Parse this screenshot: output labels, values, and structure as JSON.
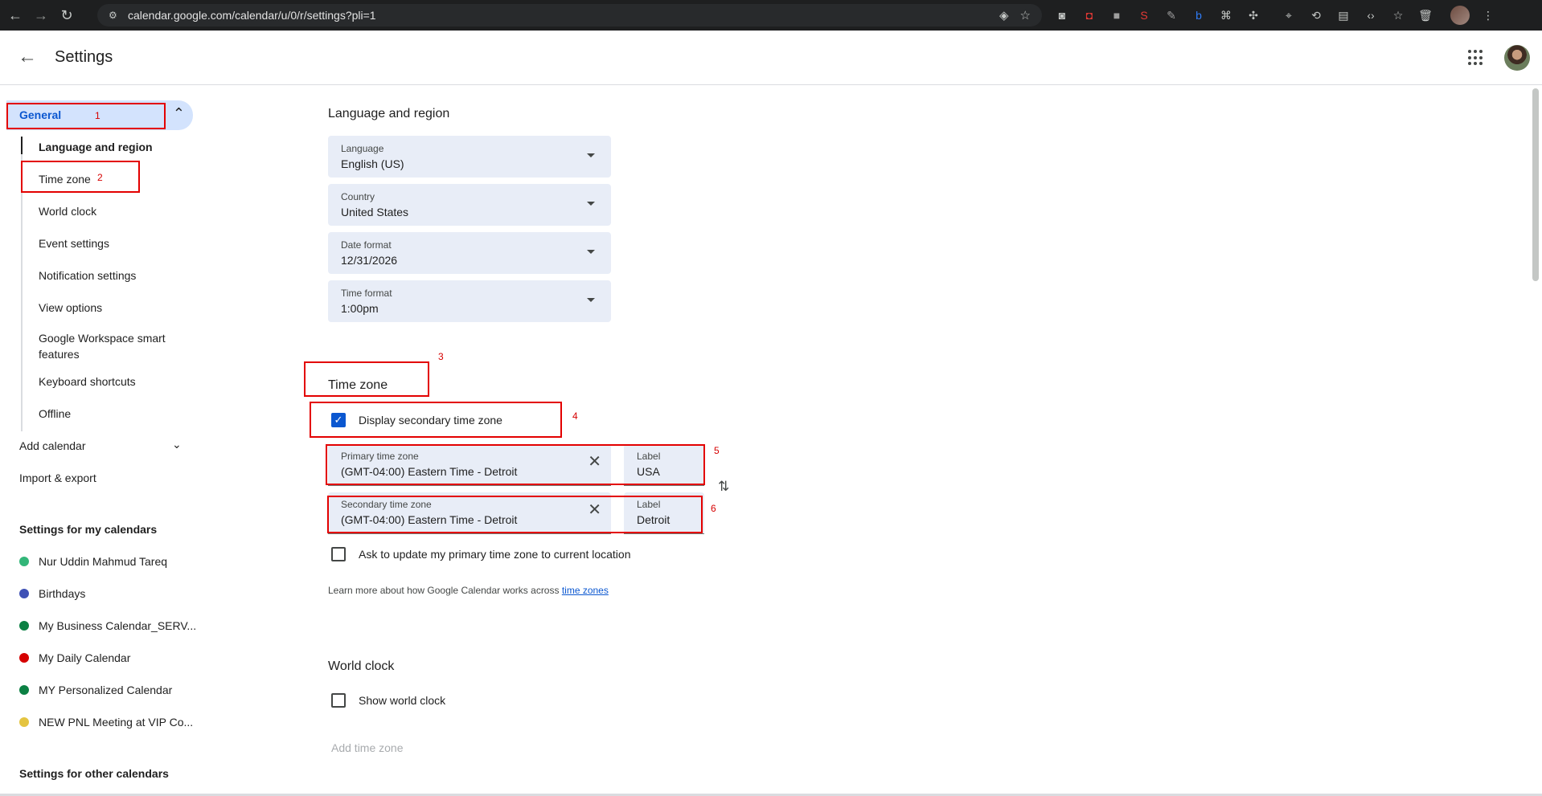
{
  "browser": {
    "url": "calendar.google.com/calendar/u/0/r/settings?pli=1"
  },
  "header": {
    "title": "Settings"
  },
  "sidebar": {
    "general": "General",
    "general_items": [
      "Language and region",
      "Time zone",
      "World clock",
      "Event settings",
      "Notification settings",
      "View options",
      "Google Workspace smart features",
      "Keyboard shortcuts",
      "Offline"
    ],
    "add_calendar": "Add calendar",
    "import_export": "Import & export",
    "my_calendars_heading": "Settings for my calendars",
    "my_calendars": [
      {
        "name": "Nur Uddin Mahmud Tareq",
        "color": "#33b679"
      },
      {
        "name": "Birthdays",
        "color": "#3f51b5"
      },
      {
        "name": "My Business Calendar_SERV...",
        "color": "#0b8043"
      },
      {
        "name": "My Daily Calendar",
        "color": "#d50000"
      },
      {
        "name": "MY Personalized Calendar",
        "color": "#0b8043"
      },
      {
        "name": "NEW PNL Meeting at VIP Co...",
        "color": "#e4c441"
      }
    ],
    "other_calendars_heading": "Settings for other calendars"
  },
  "language_region": {
    "title": "Language and region",
    "language": {
      "label": "Language",
      "value": "English (US)"
    },
    "country": {
      "label": "Country",
      "value": "United States"
    },
    "date_format": {
      "label": "Date format",
      "value": "12/31/2026"
    },
    "time_format": {
      "label": "Time format",
      "value": "1:00pm"
    }
  },
  "time_zone": {
    "title": "Time zone",
    "display_secondary": "Display secondary time zone",
    "display_secondary_checked": true,
    "primary": {
      "label": "Primary time zone",
      "value": "(GMT-04:00) Eastern Time - Detroit",
      "tag_label": "Label",
      "tag_value": "USA"
    },
    "secondary": {
      "label": "Secondary time zone",
      "value": "(GMT-04:00) Eastern Time - Detroit",
      "tag_label": "Label",
      "tag_value": "Detroit"
    },
    "ask_update": "Ask to update my primary time zone to current location",
    "ask_update_checked": false,
    "learn_more_prefix": "Learn more about how Google Calendar works across",
    "learn_more_link": "time zones"
  },
  "world_clock": {
    "title": "World clock",
    "show": "Show world clock",
    "show_checked": false,
    "add_time_zone": "Add time zone"
  },
  "annotations": [
    "1",
    "2",
    "3",
    "4",
    "5",
    "6"
  ]
}
